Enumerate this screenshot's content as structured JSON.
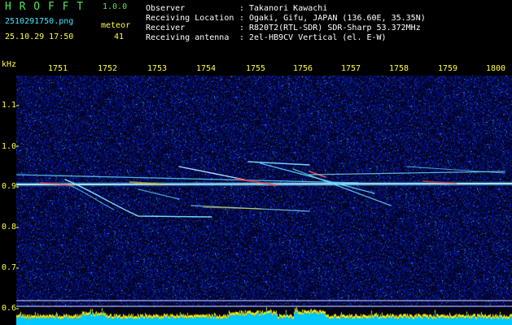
{
  "header": {
    "app_name": "H R O F F T",
    "version": "1.0.0",
    "filename": "2510291750.png",
    "datetime": "25.10.29 17:50",
    "meteor_label": "meteor",
    "meteor_count": "41"
  },
  "info": [
    {
      "label": "Observer",
      "value": "Takanori Kawachi"
    },
    {
      "label": "Receiving Location",
      "value": "Ogaki, Gifu, JAPAN (136.60E, 35.35N)"
    },
    {
      "label": "Receiver",
      "value": "R820T2(RTL-SDR) SDR-Sharp 53.372MHz"
    },
    {
      "label": "Receiving antenna",
      "value": "2el-HB9CV Vertical (el. E-W)"
    }
  ],
  "separator": ":",
  "axis": {
    "unit": "kHz",
    "x_ticks": [
      "1751",
      "1752",
      "1753",
      "1754",
      "1755",
      "1756",
      "1757",
      "1758",
      "1759",
      "1800"
    ],
    "y_ticks": [
      "1.1",
      "1.0",
      "0.9",
      "0.8",
      "0.7",
      "0.6"
    ]
  },
  "colors": {
    "background": "#000000",
    "noise": "#0a1a9a",
    "carrier": "#e8f4ff",
    "echo": "#58d8ff",
    "power_trace": "#ffee00",
    "power_fill": "#00c8ff",
    "axis_text": "#ffff3a",
    "title_green": "#56e256",
    "filename_cyan": "#46e7ff"
  }
}
